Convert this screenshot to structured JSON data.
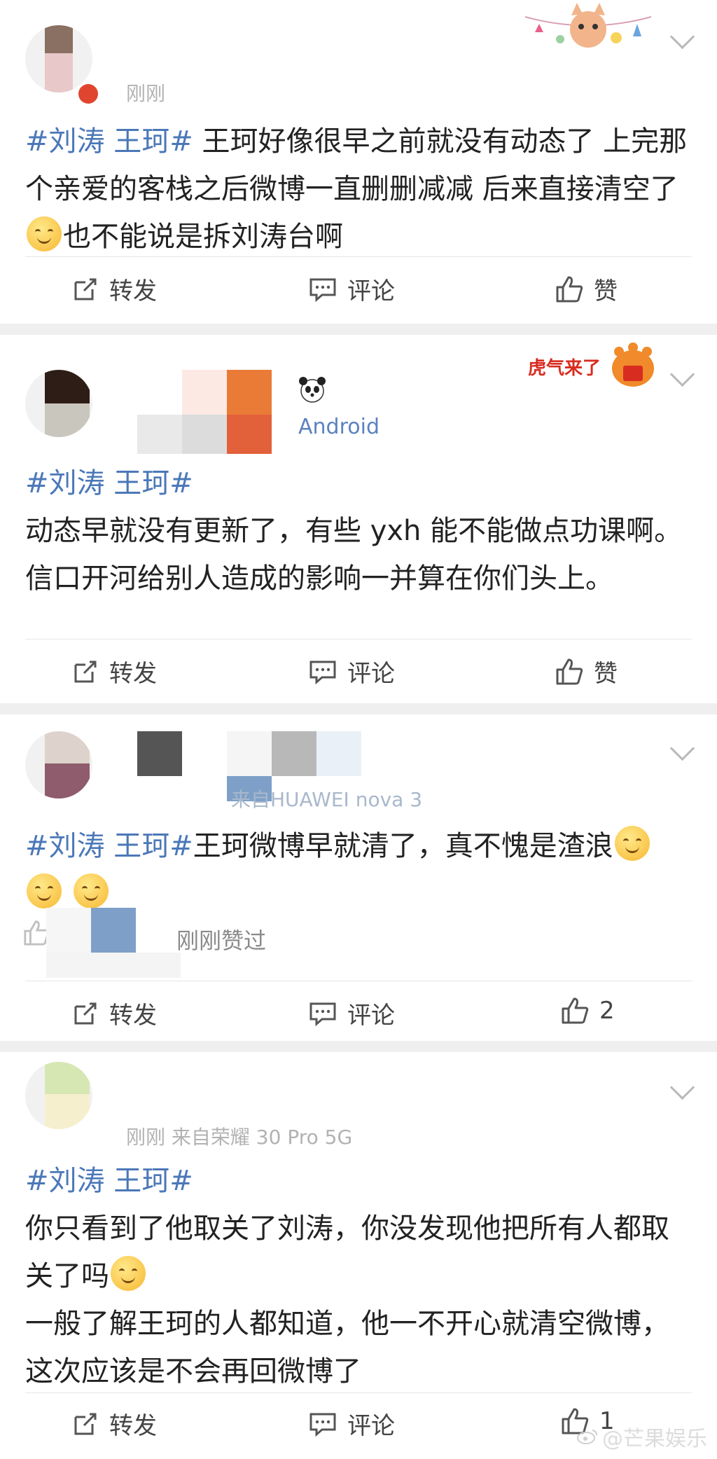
{
  "posts": [
    {
      "meta": "刚刚",
      "hashtag": "#刘涛 王珂#",
      "text": " 王珂好像很早之前就没有动态了 上完那个亲爱的客栈之后微博一直删删减减 后来直接清空了",
      "text_after_emoji": "也不能说是拆刘涛台啊",
      "actions": {
        "repost": "转发",
        "comment": "评论",
        "like": "赞"
      }
    },
    {
      "meta": "Android",
      "hashtag": "#刘涛 王珂#",
      "text": "动态早就没有更新了，有些 yxh 能不能做点功课啊。信口开河给别人造成的影响一并算在你们头上。",
      "actions": {
        "repost": "转发",
        "comment": "评论",
        "like": "赞"
      }
    },
    {
      "meta": "来自HUAWEI nova 3",
      "hashtag": "#刘涛 王珂#",
      "text": "王珂微博早就清了，真不愧是渣浪",
      "liked_note": "刚刚赞过",
      "actions": {
        "repost": "转发",
        "comment": "评论",
        "like": "2"
      }
    },
    {
      "meta": "刚刚  来自荣耀 30 Pro 5G",
      "hashtag": "#刘涛 王珂#",
      "text_line1": "你只看到了他取关了刘涛，你没发现他把所有人都取关了吗",
      "text_line2": "一般了解王珂的人都知道，他一不开心就清空微博，这次应该是不会再回微博了",
      "actions": {
        "repost": "转发",
        "comment": "评论",
        "like": "1"
      }
    }
  ],
  "badges": {
    "post2": "虎气来了"
  },
  "watermark": "@芒果娱乐",
  "colors": {
    "hashtag": "#4b78b8",
    "text": "#222222",
    "meta": "#b2b2b2",
    "background": "#efefef"
  },
  "icons": [
    "repost-icon",
    "comment-icon",
    "like-icon",
    "chevron-down-icon",
    "weibo-logo-icon"
  ]
}
